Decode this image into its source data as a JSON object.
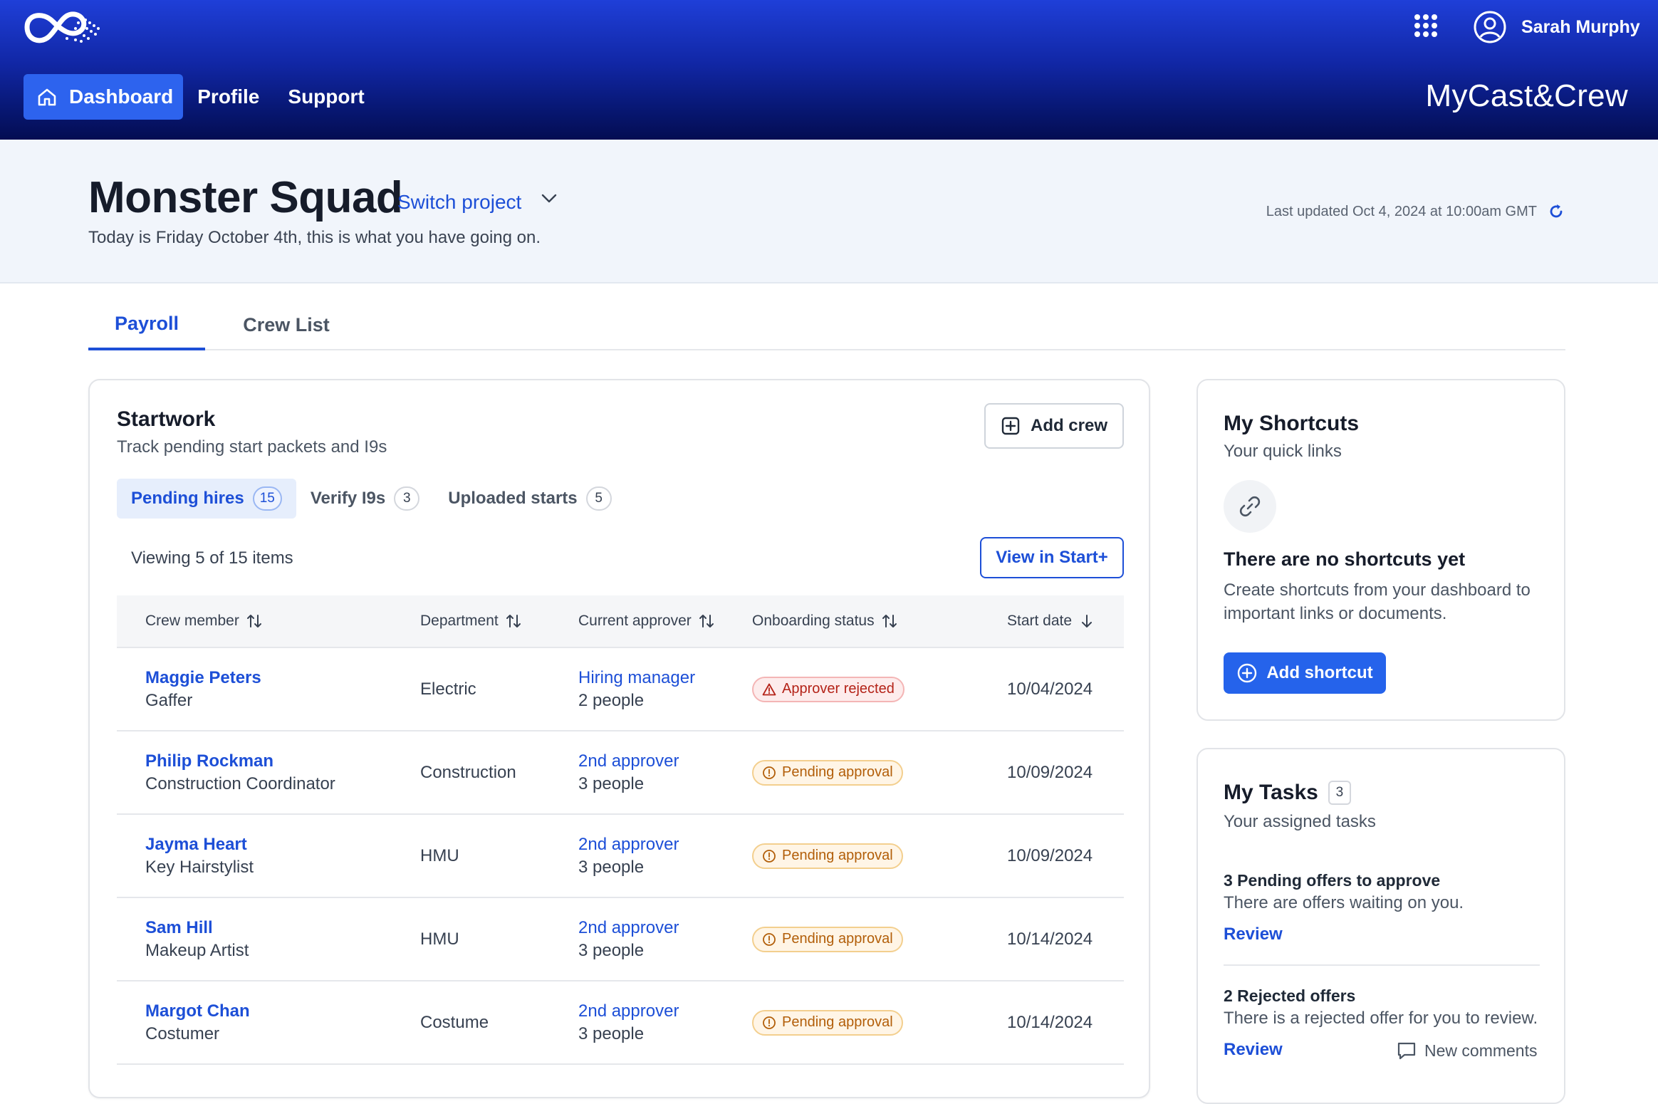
{
  "header": {
    "user_name": "Sarah Murphy",
    "brand": "MyCast&Crew",
    "nav": [
      {
        "label": "Dashboard",
        "active": true
      },
      {
        "label": "Profile"
      },
      {
        "label": "Support"
      }
    ]
  },
  "project": {
    "title": "Monster Squad",
    "switch_label": "Switch project",
    "subtitle": "Today is Friday October 4th, this is what you have going on.",
    "last_updated": "Last updated Oct 4, 2024 at 10:00am GMT"
  },
  "tabs": [
    {
      "label": "Payroll",
      "active": true
    },
    {
      "label": "Crew List"
    }
  ],
  "startwork": {
    "title": "Startwork",
    "subtitle": "Track pending start packets and I9s",
    "add_crew_label": "Add crew",
    "view_in_start_label": "View in Start+",
    "viewing_text": "Viewing 5 of 15 items",
    "subtabs": [
      {
        "label": "Pending hires",
        "count": "15",
        "active": true
      },
      {
        "label": "Verify I9s",
        "count": "3"
      },
      {
        "label": "Uploaded starts",
        "count": "5"
      }
    ],
    "columns": [
      "Crew member",
      "Department",
      "Current approver",
      "Onboarding status",
      "Start date"
    ],
    "rows": [
      {
        "name": "Maggie Peters",
        "role": "Gaffer",
        "department": "Electric",
        "approver": "Hiring manager",
        "people": "2 people",
        "status": "Approver rejected",
        "status_type": "rejected",
        "start_date": "10/04/2024"
      },
      {
        "name": "Philip Rockman",
        "role": "Construction Coordinator",
        "department": "Construction",
        "approver": "2nd approver",
        "people": "3 people",
        "status": "Pending approval",
        "status_type": "pending",
        "start_date": "10/09/2024"
      },
      {
        "name": "Jayma Heart",
        "role": "Key Hairstylist",
        "department": "HMU",
        "approver": "2nd approver",
        "people": "3 people",
        "status": "Pending approval",
        "status_type": "pending",
        "start_date": "10/09/2024"
      },
      {
        "name": "Sam Hill",
        "role": "Makeup Artist",
        "department": "HMU",
        "approver": "2nd approver",
        "people": "3 people",
        "status": "Pending approval",
        "status_type": "pending",
        "start_date": "10/14/2024"
      },
      {
        "name": "Margot Chan",
        "role": "Costumer",
        "department": "Costume",
        "approver": "2nd approver",
        "people": "3 people",
        "status": "Pending approval",
        "status_type": "pending",
        "start_date": "10/14/2024"
      }
    ]
  },
  "shortcuts": {
    "title": "My Shortcuts",
    "subtitle": "Your quick links",
    "empty_title": "There are no shortcuts yet",
    "empty_desc": "Create shortcuts from your dashboard to important links or documents.",
    "add_label": "Add shortcut"
  },
  "tasks": {
    "title": "My Tasks",
    "count": "3",
    "subtitle": "Your assigned tasks",
    "items": [
      {
        "title": "3 Pending offers to approve",
        "desc": "There are offers waiting on you.",
        "action": "Review"
      },
      {
        "title": "2 Rejected offers",
        "desc": "There is a rejected offer for you to review.",
        "action": "Review",
        "extra": "New comments"
      }
    ]
  },
  "colors": {
    "accent": "#1d4fd7",
    "header_top": "#1f3fd8",
    "header_bottom": "#040d52",
    "rejected": "#b42318",
    "pending": "#b25e09"
  }
}
